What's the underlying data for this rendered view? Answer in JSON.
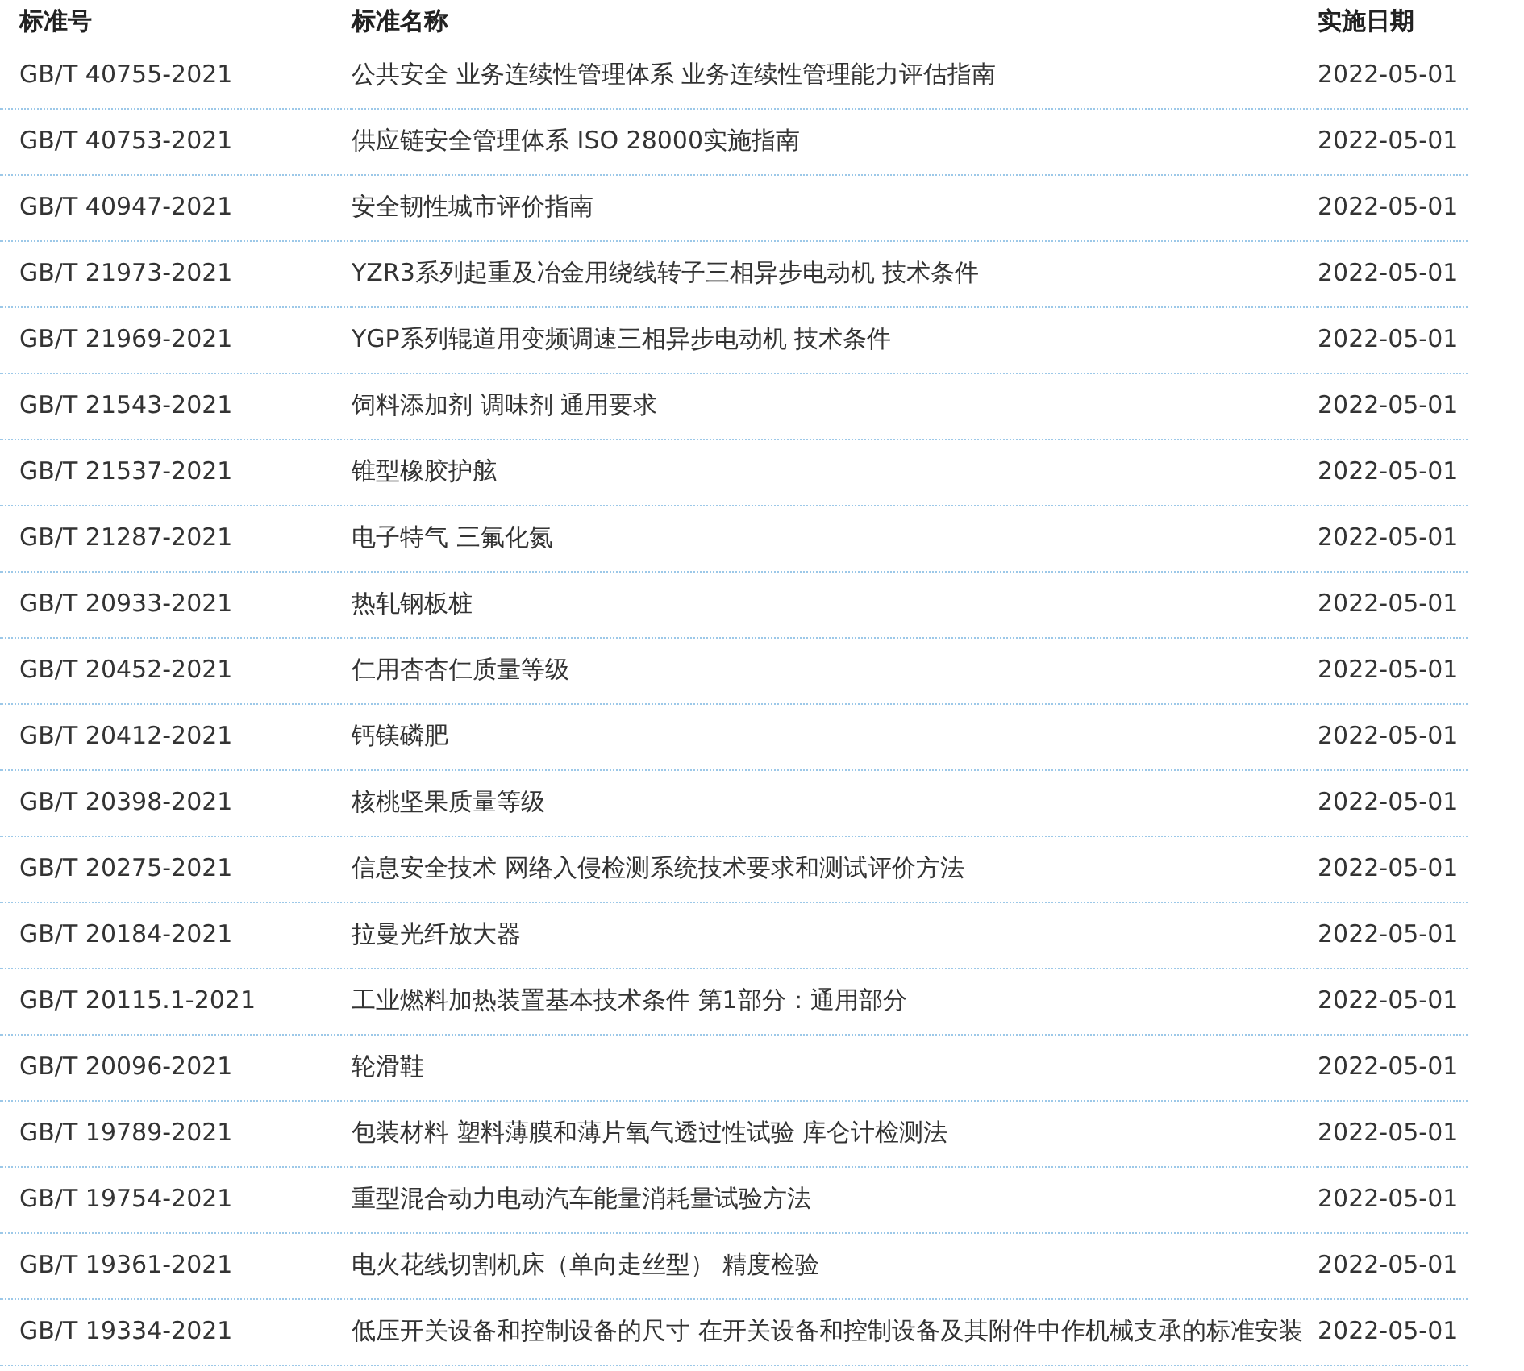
{
  "table": {
    "columns": [
      "标准号",
      "标准名称",
      "实施日期"
    ],
    "rows": [
      [
        "GB/T 40755-2021",
        "公共安全 业务连续性管理体系 业务连续性管理能力评估指南",
        "2022-05-01"
      ],
      [
        "GB/T 40753-2021",
        "供应链安全管理体系 ISO 28000实施指南",
        "2022-05-01"
      ],
      [
        "GB/T 40947-2021",
        "安全韧性城市评价指南",
        "2022-05-01"
      ],
      [
        "GB/T 21973-2021",
        "YZR3系列起重及冶金用绕线转子三相异步电动机 技术条件",
        "2022-05-01"
      ],
      [
        "GB/T 21969-2021",
        "YGP系列辊道用变频调速三相异步电动机 技术条件",
        "2022-05-01"
      ],
      [
        "GB/T 21543-2021",
        "饲料添加剂 调味剂 通用要求",
        "2022-05-01"
      ],
      [
        "GB/T 21537-2021",
        "锥型橡胶护舷",
        "2022-05-01"
      ],
      [
        "GB/T 21287-2021",
        "电子特气 三氟化氮",
        "2022-05-01"
      ],
      [
        "GB/T 20933-2021",
        "热轧钢板桩",
        "2022-05-01"
      ],
      [
        "GB/T 20452-2021",
        "仁用杏杏仁质量等级",
        "2022-05-01"
      ],
      [
        "GB/T 20412-2021",
        "钙镁磷肥",
        "2022-05-01"
      ],
      [
        "GB/T 20398-2021",
        "核桃坚果质量等级",
        "2022-05-01"
      ],
      [
        "GB/T 20275-2021",
        "信息安全技术 网络入侵检测系统技术要求和测试评价方法",
        "2022-05-01"
      ],
      [
        "GB/T 20184-2021",
        "拉曼光纤放大器",
        "2022-05-01"
      ],
      [
        "GB/T 20115.1-2021",
        "工业燃料加热装置基本技术条件 第1部分：通用部分",
        "2022-05-01"
      ],
      [
        "GB/T 20096-2021",
        "轮滑鞋",
        "2022-05-01"
      ],
      [
        "GB/T 19789-2021",
        "包装材料 塑料薄膜和薄片氧气透过性试验 库仑计检测法",
        "2022-05-01"
      ],
      [
        "GB/T 19754-2021",
        "重型混合动力电动汽车能量消耗量试验方法",
        "2022-05-01"
      ],
      [
        "GB/T 19361-2021",
        "电火花线切割机床（单向走丝型） 精度检验",
        "2022-05-01"
      ],
      [
        "GB/T 19334-2021",
        "低压开关设备和控制设备的尺寸 在开关设备和控制设备及其附件中作机械支承的标准安装",
        "2022-05-01"
      ]
    ]
  }
}
